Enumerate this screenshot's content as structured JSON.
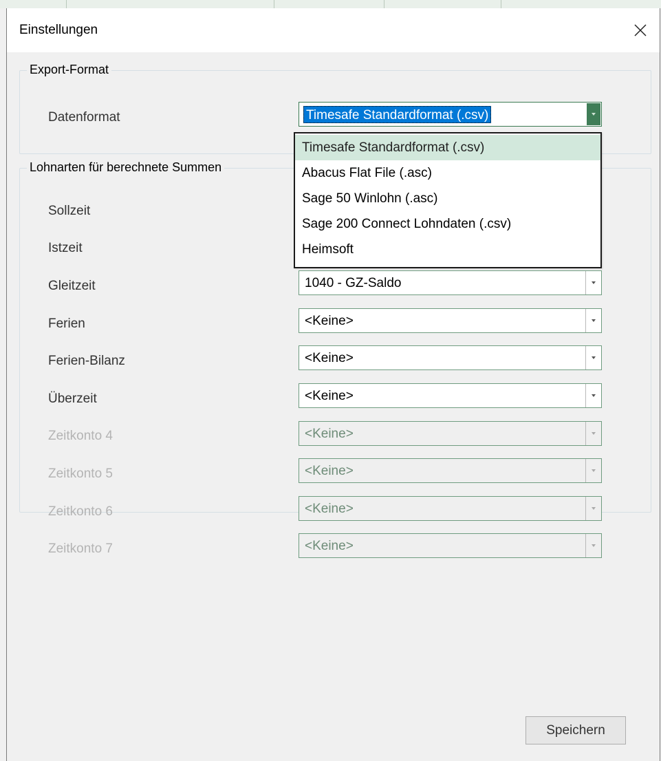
{
  "window": {
    "title": "Einstellungen"
  },
  "export_format": {
    "legend": "Export-Format",
    "datenformat_label": "Datenformat",
    "datenformat_value": "Timesafe Standardformat (.csv)",
    "options": [
      "Timesafe Standardformat (.csv)",
      "Abacus Flat File (.asc)",
      "Sage 50 Winlohn (.asc)",
      "Sage 200 Connect Lohndaten (.csv)",
      "Heimsoft"
    ]
  },
  "lohnarten": {
    "legend": "Lohnarten für berechnete Summen",
    "rows": [
      {
        "label": "Sollzeit",
        "value": ""
      },
      {
        "label": "Istzeit",
        "value": ""
      },
      {
        "label": "Gleitzeit",
        "value": "1040 - GZ-Saldo"
      },
      {
        "label": "Ferien",
        "value": "<Keine>"
      },
      {
        "label": "Ferien-Bilanz",
        "value": "<Keine>"
      },
      {
        "label": "Überzeit",
        "value": "<Keine>"
      },
      {
        "label": "Zeitkonto 4",
        "value": "<Keine>"
      },
      {
        "label": "Zeitkonto 5",
        "value": "<Keine>"
      },
      {
        "label": "Zeitkonto 6",
        "value": "<Keine>"
      },
      {
        "label": "Zeitkonto 7",
        "value": "<Keine>"
      }
    ]
  },
  "buttons": {
    "save_label": "Speichern"
  },
  "colors": {
    "accent": "#3f7d57",
    "selection": "#0078d7",
    "dropdown_hover": "#d2e8dc",
    "disabled_text": "#b4b4b4"
  }
}
